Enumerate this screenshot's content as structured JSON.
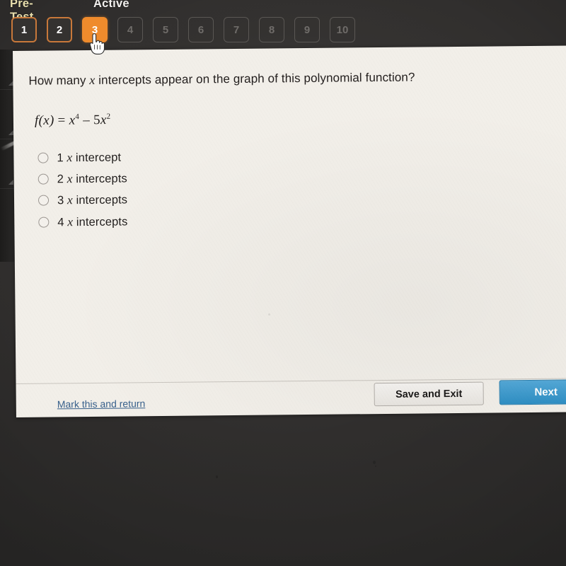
{
  "header": {
    "pretest_label": "Pre-Test",
    "active_label": "Active",
    "questions": [
      {
        "number": "1",
        "state": "visited"
      },
      {
        "number": "2",
        "state": "visited"
      },
      {
        "number": "3",
        "state": "current"
      },
      {
        "number": "4",
        "state": "locked"
      },
      {
        "number": "5",
        "state": "locked"
      },
      {
        "number": "6",
        "state": "locked"
      },
      {
        "number": "7",
        "state": "locked"
      },
      {
        "number": "8",
        "state": "locked"
      },
      {
        "number": "9",
        "state": "locked"
      },
      {
        "number": "10",
        "state": "locked"
      }
    ]
  },
  "question": {
    "prompt_part1": "How many ",
    "prompt_var": "x",
    "prompt_part2": " intercepts appear on the graph of this polynomial function?",
    "formula_fx": "f(x)",
    "formula_equals": " = ",
    "formula_term1_base": "x",
    "formula_term1_exp": "4",
    "formula_operator": " – ",
    "formula_term2_coef": "5",
    "formula_term2_base": "x",
    "formula_term2_exp": "2",
    "options": [
      {
        "number": "1",
        "var": "x",
        "suffix": " intercept",
        "selected": false
      },
      {
        "number": "2",
        "var": "x",
        "suffix": " intercepts",
        "selected": false
      },
      {
        "number": "3",
        "var": "x",
        "suffix": " intercepts",
        "selected": false
      },
      {
        "number": "4",
        "var": "x",
        "suffix": " intercepts",
        "selected": false
      }
    ]
  },
  "actions": {
    "mark_return_label": "Mark this and return",
    "save_exit_label": "Save and Exit",
    "next_label": "Next"
  },
  "colors": {
    "accent_orange": "#ef8b2c",
    "visited_border": "#c8783a",
    "next_blue": "#2f8fc4",
    "link_blue": "#39618c",
    "pretest_yellow": "#e8dfae",
    "dark_background": "#2e2c2b",
    "card_background": "#f2efe9"
  },
  "cursor": {
    "icon": "pointing-hand-cursor"
  }
}
